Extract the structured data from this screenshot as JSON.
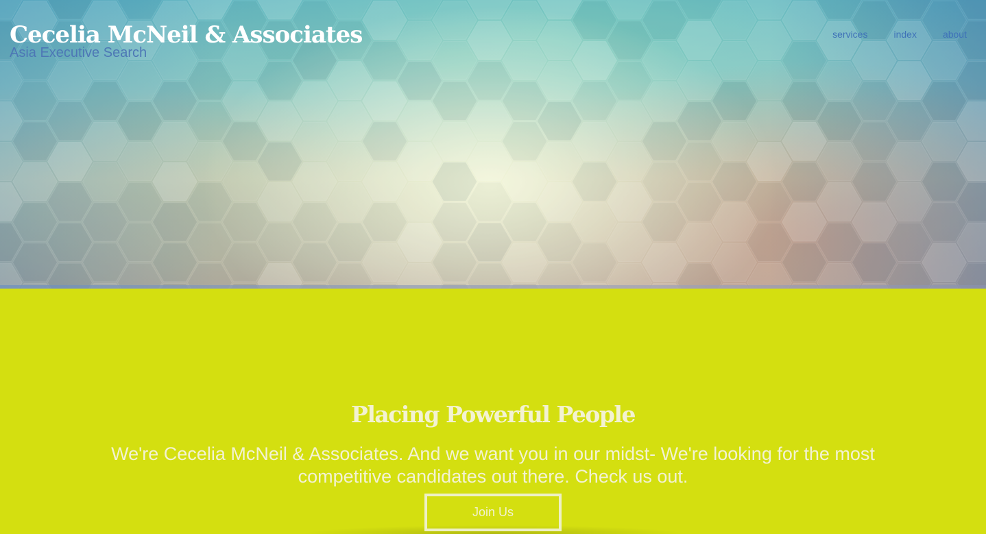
{
  "header": {
    "title": "Cecelia McNeil & Associates",
    "subtitle": "Asia Executive Search",
    "nav": [
      {
        "label": "services"
      },
      {
        "label": "index"
      },
      {
        "label": "about"
      }
    ]
  },
  "hero": {
    "background": "hexagon-pattern",
    "colors": {
      "top": "#5fb4c2",
      "center": "#f0f2d6",
      "bottom_right": "#b89a8c"
    }
  },
  "main": {
    "background_color": "#d4df10",
    "headline": "Placing Powerful People",
    "blurb": "We're Cecelia McNeil & Associates. And we want you in our midst- We're looking for the most competitive candidates out there. Check us out.",
    "cta_label": "Join Us"
  }
}
